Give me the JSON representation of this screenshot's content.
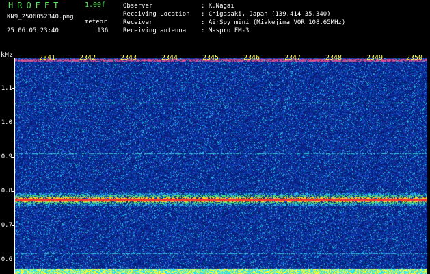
{
  "header": {
    "app_name": "HROFFT",
    "version": "1.00f",
    "filename": "KN9_2506052340.png",
    "mode": "meteor",
    "datetime": "25.06.05 23:40",
    "count": "136"
  },
  "info": [
    {
      "label": "Observer",
      "value": ": K.Nagai"
    },
    {
      "label": "Receiving Location",
      "value": ": Chigasaki, Japan (139.414 35.340)"
    },
    {
      "label": "Receiver",
      "value": ": AirSpy mini (Miakejima VOR 108.65MHz)"
    },
    {
      "label": "Receiving antenna",
      "value": ": Maspro FM-3"
    }
  ],
  "axis": {
    "unit": "kHz",
    "ticks": [
      "1.1",
      "1.0",
      "0.9",
      "0.8",
      "0.7",
      "0.6"
    ]
  },
  "time_marks": [
    "2341",
    "2342",
    "2343",
    "2344",
    "2345",
    "2346",
    "2347",
    "2348",
    "2349",
    "2350"
  ],
  "colors": {
    "title_green": "#5fe65f",
    "mark_yellow": "#ffff40",
    "background_noise": "#1030a0",
    "carrier_red": "#ff3030"
  }
}
